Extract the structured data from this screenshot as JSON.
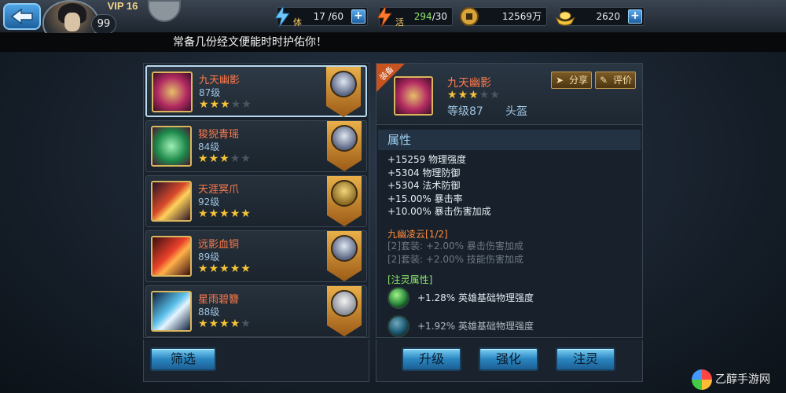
{
  "player": {
    "vip": "VIP 16",
    "level": "99"
  },
  "resources": {
    "stamina": {
      "label": "体",
      "value": "17 /60"
    },
    "energy": {
      "label": "活",
      "value": "294",
      "max": "/30"
    },
    "copper": {
      "value": "12569万"
    },
    "gold": {
      "value": "2620"
    }
  },
  "notice": "常备几份经文便能时时护佑你！",
  "items": [
    {
      "name": "九天幽影",
      "level": "87级",
      "stars": 3,
      "max_stars": 5
    },
    {
      "name": "狻猊青瑶",
      "level": "84级",
      "stars": 3,
      "max_stars": 5
    },
    {
      "name": "天涯冥爪",
      "level": "92级",
      "stars": 5,
      "max_stars": 5
    },
    {
      "name": "远影血铜",
      "level": "89级",
      "stars": 5,
      "max_stars": 5
    },
    {
      "name": "星雨碧簪",
      "level": "88级",
      "stars": 4,
      "max_stars": 5
    }
  ],
  "detail": {
    "ribbon": "装备",
    "name": "九天幽影",
    "stars": 3,
    "max_stars": 5,
    "level": "等级87",
    "slot": "头盔",
    "share_label": "分享",
    "rate_label": "评价",
    "attr_title": "属性",
    "attributes": [
      "+15259 物理强度",
      "+5304 物理防御",
      "+5304 法术防御",
      "+15.00% 暴击率",
      "+10.00% 暴击伤害加成"
    ],
    "set_title": "九幽凌云[1/2]",
    "set_bonuses": [
      "[2]套装: +2.00% 暴击伤害加成",
      "[2]套装: +2.00% 技能伤害加成"
    ],
    "spirit_title": "[注灵属性]",
    "spirit_attrs": [
      "+1.28% 英雄基础物理强度",
      "+1.92% 英雄基础物理强度"
    ]
  },
  "buttons": {
    "filter": "筛选",
    "upgrade": "升级",
    "enhance": "强化",
    "spirit": "注灵"
  },
  "watermark": "乙醇手游网",
  "colors": {
    "star_on": "#f6c436",
    "star_off": "#4a5560",
    "item_name": "#ff7a4a",
    "button_blue": "#2a85bf"
  }
}
